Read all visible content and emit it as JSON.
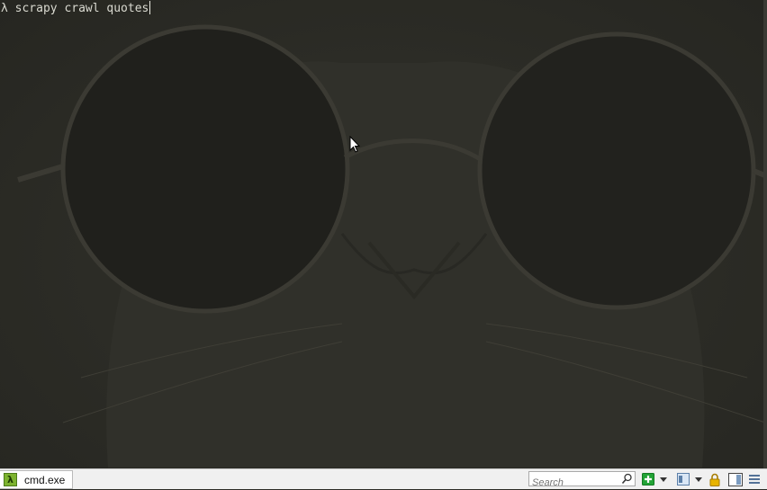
{
  "terminal": {
    "prompt_symbol": "λ",
    "command": "scrapy crawl quotes"
  },
  "taskbar": {
    "tab_label": "cmd.exe",
    "tab_icon": "lambda-icon"
  },
  "search": {
    "placeholder": "Search"
  },
  "colors": {
    "terminal_text": "#d9d9d0",
    "terminal_bg": "#2d2d27",
    "add_green": "#22a336",
    "tab_icon_green": "#7db32f"
  },
  "icons": [
    "search-icon",
    "add-icon",
    "dropdown-arrow-icon",
    "view-icon",
    "lock-icon",
    "panel-icon",
    "menu-icon",
    "mouse-cursor-icon"
  ]
}
